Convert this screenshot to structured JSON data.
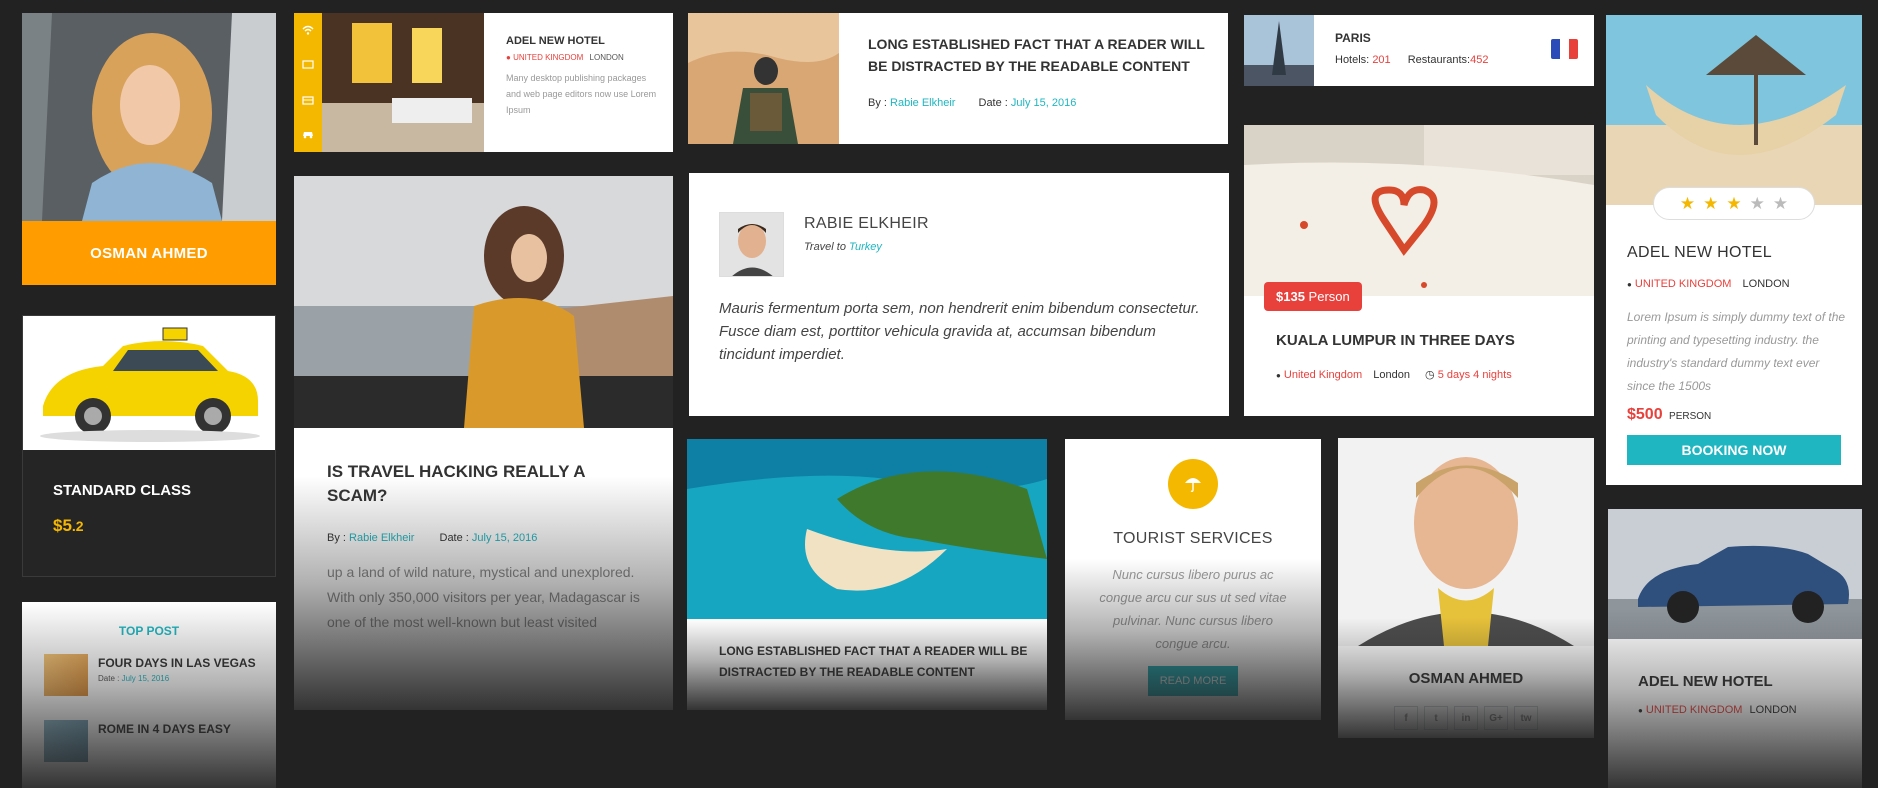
{
  "driver_card": {
    "name": "OSMAN AHMED"
  },
  "taxi_card": {
    "title": "STANDARD CLASS",
    "price_main": "$5",
    "price_cents": ".2"
  },
  "top_post": {
    "heading": "TOP POST",
    "items": [
      {
        "title": "FOUR DAYS IN LAS VEGAS",
        "date_label": "Date :",
        "date": "July 15, 2016"
      },
      {
        "title": "ROME IN 4 DAYS EASY"
      }
    ]
  },
  "hotel_small": {
    "title": "ADEL NEW HOTEL",
    "country": "UNITED KINGDOM",
    "city": "LONDON",
    "description": "Many desktop publishing packages and web page editors now use Lorem Ipsum"
  },
  "blog_post": {
    "title": "IS TRAVEL HACKING REALLY A SCAM?",
    "by_label": "By :",
    "author": "Rabie Elkheir",
    "date_label": "Date :",
    "date": "July 15, 2016",
    "excerpt": "up a land of wild nature, mystical and unexplored. With only 350,000 visitors per year, Madagascar is one of the most well-known but least visited"
  },
  "article_wide": {
    "title": "LONG ESTABLISHED FACT THAT A READER WILL BE DISTRACTED BY THE READABLE CONTENT",
    "by_label": "By :",
    "author": "Rabie Elkheir",
    "date_label": "Date :",
    "date": "July 15, 2016"
  },
  "testimonial": {
    "name": "RABIE ELKHEIR",
    "travel_label": "Travel to",
    "destination": "Turkey",
    "quote": "Mauris fermentum porta sem, non hendrerit enim bibendum consectetur. Fusce diam est, porttitor vehicula gravida at, accumsan bibendum tincidunt imperdiet."
  },
  "island_article": {
    "title": "LONG ESTABLISHED FACT THAT A READER WILL BE DISTRACTED BY THE READABLE CONTENT"
  },
  "tourist_services": {
    "title": "TOURIST SERVICES",
    "text": "Nunc cursus libero purus ac congue arcu cur sus ut sed vitae pulvinar. Nunc cursus libero congue arcu.",
    "button": "READ MORE"
  },
  "paris_card": {
    "city": "PARIS",
    "hotels_label": "Hotels:",
    "hotels": "201",
    "restaurants_label": "Restaurants:",
    "restaurants": "452"
  },
  "tour_card": {
    "price": "$135",
    "price_unit": "Person",
    "title": "KUALA LUMPUR IN THREE DAYS",
    "country": "United Kingdom",
    "city": "London",
    "duration": "5 days 4 nights"
  },
  "profile_card": {
    "name": "OSMAN AHMED",
    "socials": [
      "f",
      "t",
      "in",
      "G+",
      "tw"
    ]
  },
  "hotel_booking": {
    "rating": 3,
    "rating_max": 5,
    "title": "ADEL NEW HOTEL",
    "country": "UNITED KINGDOM",
    "city": "LONDON",
    "description": "Lorem Ipsum is simply dummy text of the printing and typesetting industry. the industry's standard dummy text ever since the 1500s",
    "price": "$500",
    "price_unit": "PERSON",
    "button": "BOOKING NOW"
  },
  "car_hotel_card": {
    "title": "ADEL NEW HOTEL",
    "country": "UNITED KINGDOM",
    "city": "LONDON"
  },
  "colors": {
    "accent_teal": "#1fb6c1",
    "accent_orange": "#ff9c00",
    "accent_red": "#e8413c",
    "gold": "#f5b800"
  }
}
